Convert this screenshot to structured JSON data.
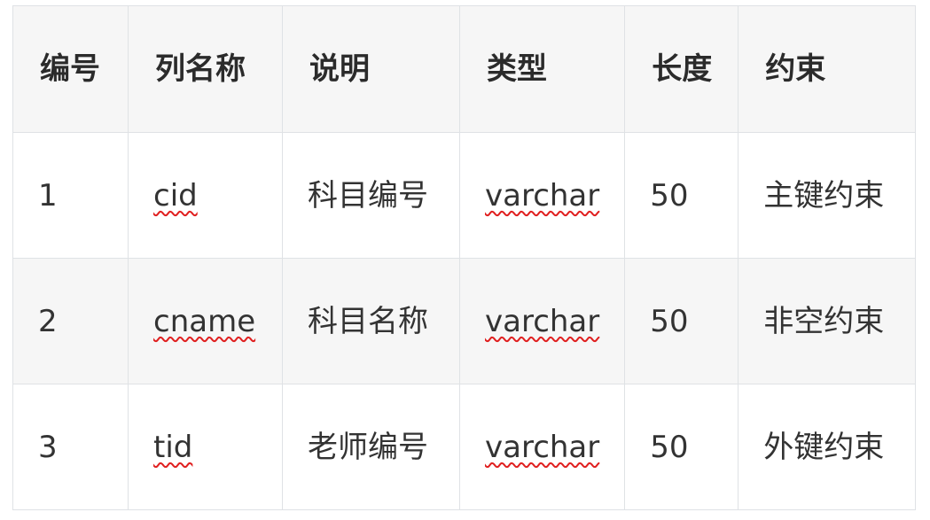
{
  "table": {
    "headers": [
      "编号",
      "列名称",
      "说明",
      "类型",
      "长度",
      "约束"
    ],
    "rows": [
      [
        "1",
        "cid",
        "科目编号",
        "varchar",
        "50",
        "主键约束"
      ],
      [
        "2",
        "cname",
        "科目名称",
        "varchar",
        "50",
        "非空约束"
      ],
      [
        "3",
        "tid",
        "老师编号",
        "varchar",
        "50",
        "外键约束"
      ]
    ]
  }
}
